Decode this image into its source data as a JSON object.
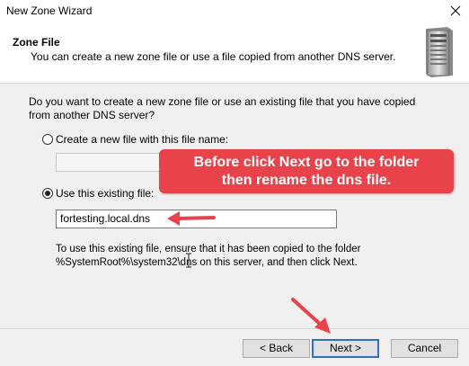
{
  "window": {
    "title": "New Zone Wizard"
  },
  "header": {
    "title": "Zone File",
    "subtitle": "You can create a new zone file or use a file copied from another DNS server."
  },
  "question": "Do you want to create a new zone file or use an existing file that you have copied from another DNS server?",
  "options": {
    "create_new_label": "Create a new file with this file name:",
    "create_new_value": "",
    "use_existing_label": "Use this existing file:",
    "use_existing_value": "fortesting.local.dns",
    "selected": "use_existing"
  },
  "note": {
    "line1": "To use this existing file, ensure that it has been copied to the folder",
    "line2": "%SystemRoot%\\system32\\dns on this server, and then click Next."
  },
  "annotation": {
    "line1": "Before click Next go to the folder",
    "line2": "then rename the dns file.",
    "color": "#e8434a"
  },
  "buttons": {
    "back": "< Back",
    "next": "Next >",
    "cancel": "Cancel"
  }
}
